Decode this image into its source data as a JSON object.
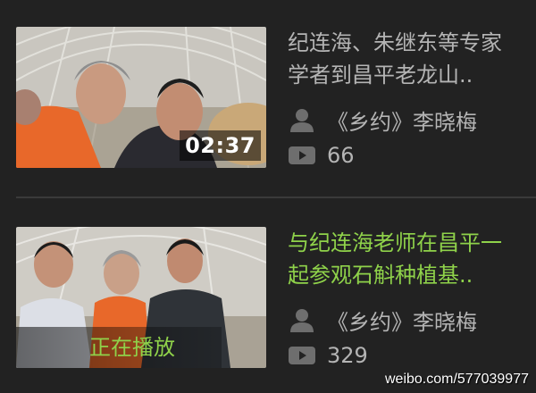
{
  "videos": [
    {
      "title_line1": "纪连海、朱继东等专家",
      "title_line2": "学者到昌平老龙山..",
      "author": "《乡约》李晓梅",
      "plays": "66",
      "duration": "02:37",
      "playing_label": ""
    },
    {
      "title_line1": "与纪连海老师在昌平一",
      "title_line2": "起参观石斛种植基..",
      "author": "《乡约》李晓梅",
      "plays": "329",
      "duration": "",
      "playing_label": "正在播放"
    }
  ],
  "watermark": "weibo.com/577039977",
  "colors": {
    "background": "#222222",
    "text_muted": "#b4b4b4",
    "accent_green": "#8fd24a",
    "divider": "#3a3a3a"
  },
  "icons": [
    "user-icon",
    "play-count-icon"
  ]
}
